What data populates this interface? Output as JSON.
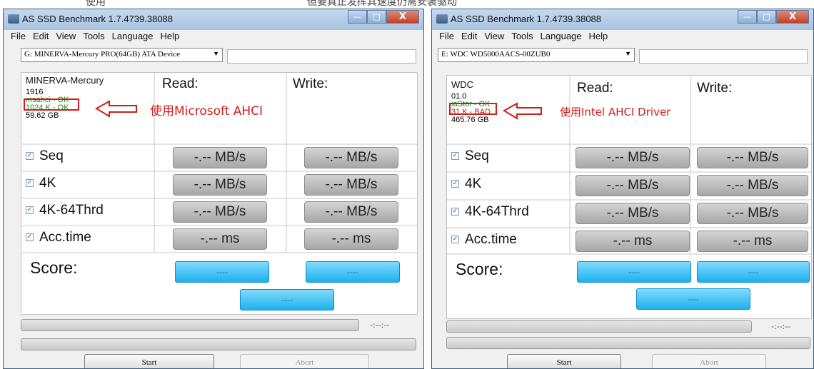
{
  "top_fragments": [
    "使用",
    "但要真正发挥其速度仍需安装驱动"
  ],
  "menu": [
    "File",
    "Edit",
    "View",
    "Tools",
    "Language",
    "Help"
  ],
  "columns": {
    "read": "Read:",
    "write": "Write:"
  },
  "tests": [
    "Seq",
    "4K",
    "4K-64Thrd",
    "Acc.time"
  ],
  "score_label": "Score:",
  "left": {
    "title": "AS SSD Benchmark 1.7.4739.38088",
    "drive": "G: MINERVA-Mercury PRO(64GB) ATA Device",
    "info": [
      "MINERVA-Mercury",
      "1916",
      "msahci - OK",
      "1024 K - OK",
      "59.62 GB"
    ],
    "annotation": "使用Microsoft AHCI",
    "results": [
      [
        "-.-- MB/s",
        "-.-- MB/s"
      ],
      [
        "-.-- MB/s",
        "-.-- MB/s"
      ],
      [
        "-.-- MB/s",
        "-.-- MB/s"
      ],
      [
        "-.-- ms",
        "-.-- ms"
      ]
    ],
    "scores": {
      "read": "----",
      "write": "----",
      "total": "----"
    },
    "elapsed": "-:--:--",
    "start": "Start",
    "abort": "Abort"
  },
  "right": {
    "title": "AS SSD Benchmark 1.7.4739.38088",
    "drive": "E: WDC WD5000AACS-00ZUB0",
    "info": [
      "WDC",
      "01.0",
      "iaStor - OK",
      "31 K - BAD",
      "465.76 GB"
    ],
    "annotation": "使用Intel AHCI Driver",
    "results": [
      [
        "-.-- MB/s",
        "-.-- MB/s"
      ],
      [
        "-.-- MB/s",
        "-.-- MB/s"
      ],
      [
        "-.-- MB/s",
        "-.-- MB/s"
      ],
      [
        "-.-- ms",
        "-.-- ms"
      ]
    ],
    "scores": {
      "read": "----",
      "write": "----",
      "total": "----"
    },
    "elapsed": "-:--:--",
    "start": "Start",
    "abort": "Abort"
  }
}
